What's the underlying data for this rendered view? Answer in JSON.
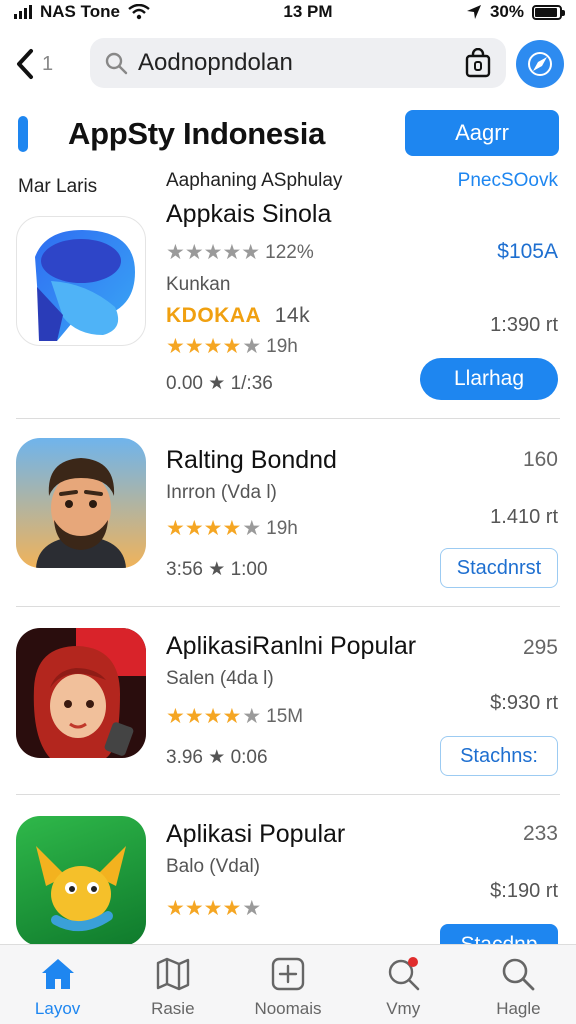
{
  "status": {
    "carrier": "NAS Tone",
    "time": "13 PM",
    "battery": "30%"
  },
  "search": {
    "back_suffix": "1",
    "query": "Aodnopndolan"
  },
  "header": {
    "title": "AppSty Indonesia",
    "button": "Aagrr"
  },
  "subheader": {
    "left": "Mar Laris",
    "middle": "Aaphaning ASphulay",
    "right": "PnecSOovk"
  },
  "apps": [
    {
      "name": "Appkais Sinola",
      "rating_count": "122%",
      "right_top": "$105A",
      "sub": "Kunkan",
      "brand": "KDOKAA",
      "brand_count": "14k",
      "second_rating_count": "19h",
      "right_mid": "1:390 rt",
      "meta": "0.00 ★ 1/:36",
      "button": "Llarhag"
    },
    {
      "name": "Ralting Bondnd",
      "sub": "Inrron (Vda l)",
      "rating_count": "19h",
      "meta": "3:56 ★ 1:00",
      "right_top": "160",
      "right_mid": "1.410 rt",
      "button": "Stacdnrst"
    },
    {
      "name": "AplikasiRanlni Popular",
      "sub": "Salen (4da l)",
      "rating_count": "15M",
      "meta": "3.96 ★ 0:06",
      "right_top": "295",
      "right_mid": "$:930 rt",
      "button": "Stachns:"
    },
    {
      "name": "Aplikasi Popular",
      "sub": "Balo (Vdal)",
      "right_top": "233",
      "right_mid": "$:190 rt",
      "button": "Stacdnp"
    }
  ],
  "tabs": [
    {
      "label": "Layov",
      "icon": "home-icon"
    },
    {
      "label": "Rasie",
      "icon": "map-icon"
    },
    {
      "label": "Noomais",
      "icon": "plus-square-icon"
    },
    {
      "label": "Vmy",
      "icon": "notification-search-icon"
    },
    {
      "label": "Hagle",
      "icon": "search-icon"
    }
  ],
  "colors": {
    "accent": "#1e86f0",
    "star": "#f5a623",
    "brand": "#f0a010"
  }
}
